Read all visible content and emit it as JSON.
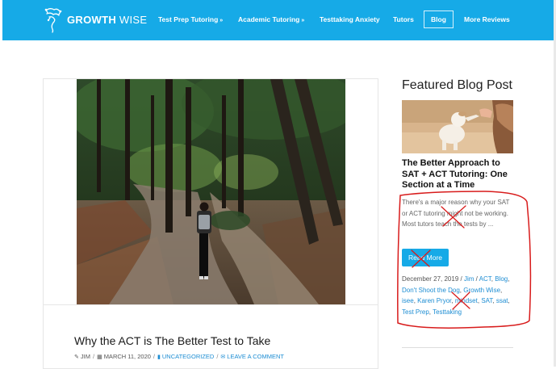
{
  "nav": {
    "brand_bold": "GROWTH",
    "brand_light": " WISE",
    "items": [
      {
        "label": "Test Prep Tutoring",
        "chevron": "»"
      },
      {
        "label": "Academic Tutoring",
        "chevron": "»"
      },
      {
        "label": "Testtaking Anxiety"
      },
      {
        "label": "Tutors"
      },
      {
        "label": "Blog"
      },
      {
        "label": "More Reviews"
      }
    ],
    "colors": {
      "bar": "#16aae7",
      "text": "#ffffff"
    }
  },
  "main_post": {
    "title": "Why the ACT is The Better Test to Take",
    "author": "JIM",
    "date": "MARCH 11, 2020",
    "category": "UNCATEGORIZED",
    "comment": "LEAVE A COMMENT",
    "icons": {
      "author": "pencil-icon",
      "date": "calendar-icon",
      "category": "bookmark-icon",
      "comment": "comment-icon"
    }
  },
  "sidebar": {
    "heading": "Featured Blog Post",
    "post_title": "The Better Approach to SAT + ACT Tutoring: One Section at a Time",
    "excerpt": "There's a major reason why your SAT or ACT tutoring might not be working. Most tutors teach the tests by ...",
    "read_more": "Read More",
    "date": "December 27, 2019",
    "author": "Jim",
    "tags_line1": [
      "ACT",
      "Blog"
    ],
    "tags_line2": [
      "Don't Shoot the Dog",
      "Growth Wise"
    ],
    "tags_line3": [
      "isee",
      "Karen Pryor",
      "mindset",
      "SAT",
      "ssat"
    ],
    "tags_line4": [
      "Test Prep",
      "Testtaking"
    ]
  },
  "colors": {
    "accent": "#16aae7",
    "link": "#1d8dd3",
    "annotation": "#d81b1b"
  }
}
